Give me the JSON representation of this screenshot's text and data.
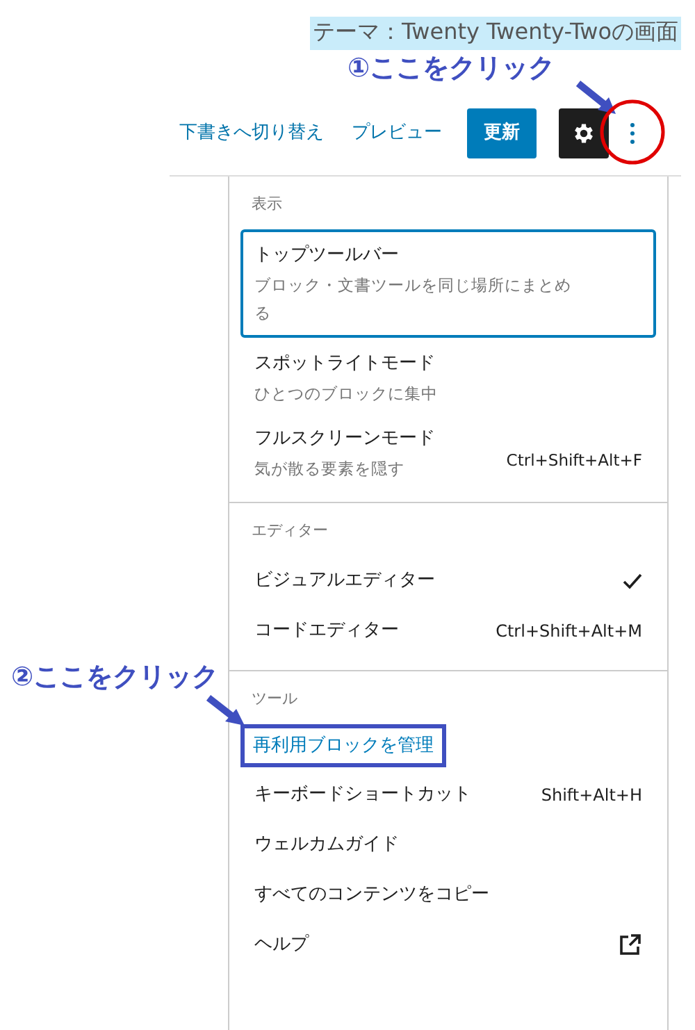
{
  "caption": "テーマ：Twenty Twenty-Twoの画面",
  "annotations": [
    {
      "text": "①ここをクリック"
    },
    {
      "text": "②ここをクリック"
    }
  ],
  "toolbar": {
    "switch_to_draft": "下書きへ切り替え",
    "preview": "プレビュー",
    "update": "更新"
  },
  "menu": {
    "sections": [
      {
        "label": "表示",
        "items": [
          {
            "kind": "option",
            "label": "トップツールバー",
            "description": "ブロック・文書ツールを同じ場所にまとめる",
            "focused": true
          },
          {
            "kind": "option",
            "label": "スポットライトモード",
            "description": "ひとつのブロックに集中",
            "focused": false
          },
          {
            "kind": "option",
            "label": "フルスクリーンモード",
            "description": "気が散る要素を隠す",
            "shortcut": "Ctrl+Shift+Alt+F",
            "focused": false
          }
        ]
      },
      {
        "label": "エディター",
        "items": [
          {
            "kind": "mode",
            "label": "ビジュアルエディター",
            "checked": true
          },
          {
            "kind": "mode",
            "label": "コードエディター",
            "shortcut": "Ctrl+Shift+Alt+M",
            "checked": false
          }
        ]
      },
      {
        "label": "ツール",
        "items": [
          {
            "kind": "tool",
            "label": "再利用ブロックを管理",
            "callout": true
          },
          {
            "kind": "tool",
            "label": "キーボードショートカット",
            "shortcut": "Shift+Alt+H",
            "callout": false
          },
          {
            "kind": "tool",
            "label": "ウェルカムガイド",
            "callout": false
          },
          {
            "kind": "tool",
            "label": "すべてのコンテンツをコピー",
            "callout": false
          },
          {
            "kind": "external",
            "label": "ヘルプ"
          }
        ]
      }
    ]
  }
}
